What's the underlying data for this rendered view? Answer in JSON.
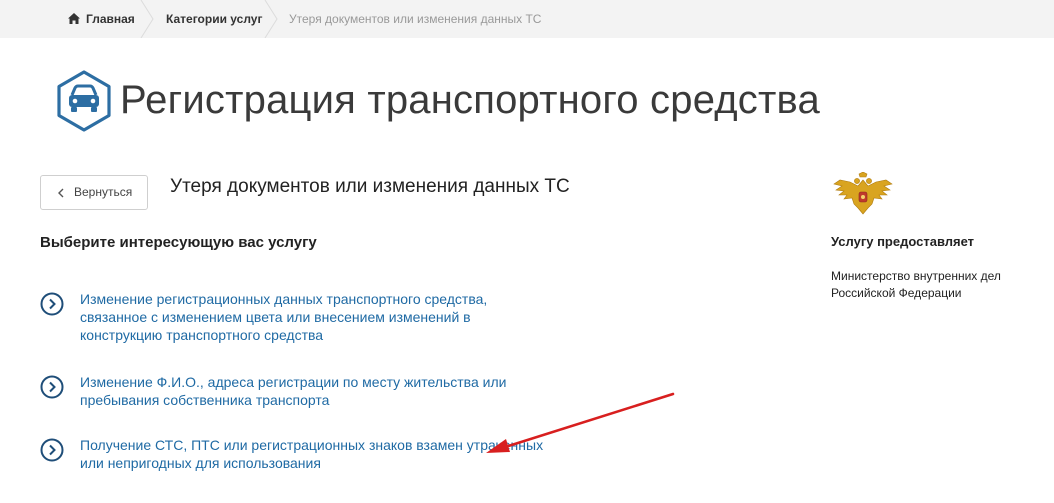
{
  "breadcrumb": {
    "home": "Главная",
    "categories": "Категории услуг",
    "current": "Утеря документов или изменения данных ТС"
  },
  "page": {
    "title": "Регистрация транспортного средства",
    "section_title": "Утеря документов или изменения данных ТС",
    "back_label": "Вернуться",
    "choose_heading": "Выберите интересующую вас услугу"
  },
  "services": [
    {
      "label": "Изменение регистрационных данных транспортного средства, связанное с изменением цвета или внесением изменений в конструкцию транспортного средства"
    },
    {
      "label": "Изменение Ф.И.О., адреса регистрации по месту жительства или пребывания собственника транспорта"
    },
    {
      "label": "Получение СТС, ПТС или регистрационных знаков взамен утраченных или непригодных для использования"
    }
  ],
  "provider": {
    "heading": "Услугу предоставляет",
    "name": "Министерство внутренних дел Российской Федерации"
  },
  "icons": {
    "home": "home-icon",
    "hero": "car-icon",
    "back": "chevron-left-icon",
    "service": "chevron-right-circle-icon",
    "emblem": "double-headed-eagle-icon"
  },
  "colors": {
    "accent": "#1f6aa4",
    "icon_blue": "#2d6ea3",
    "breadcrumb_bg": "#f3f3f3",
    "annotation_red": "#d81f1f",
    "emblem_gold": "#d9a420"
  }
}
